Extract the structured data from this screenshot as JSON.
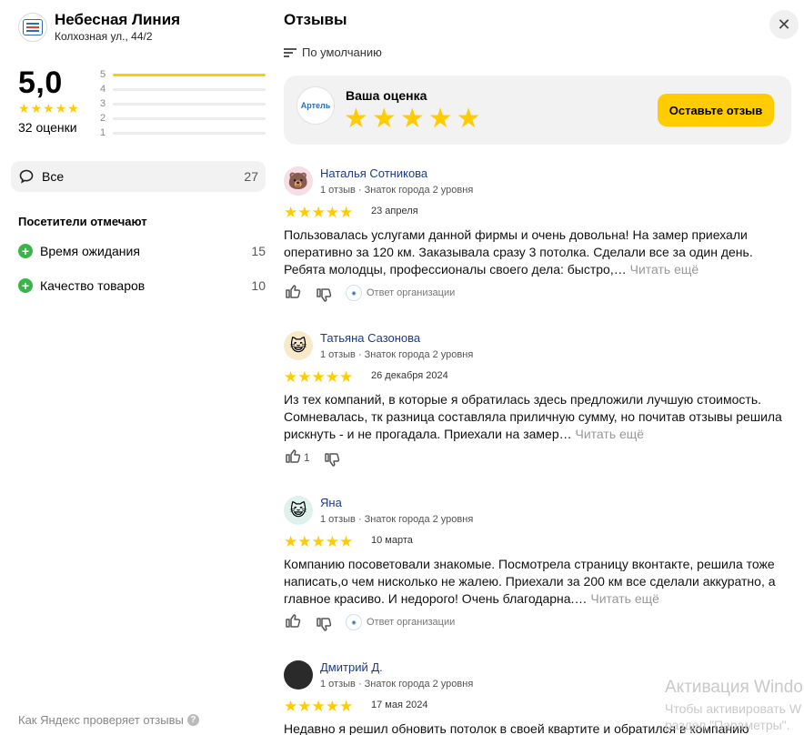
{
  "organization": {
    "name": "Небесная Линия",
    "address": "Колхозная ул., 44/2",
    "logo_icon": "company-logo"
  },
  "rating": {
    "value": "5,0",
    "stars": 5,
    "count_label": "32 оценки",
    "distribution": [
      {
        "label": "5",
        "fraction": 1.0
      },
      {
        "label": "4",
        "fraction": 0.0
      },
      {
        "label": "3",
        "fraction": 0.0
      },
      {
        "label": "2",
        "fraction": 0.0
      },
      {
        "label": "1",
        "fraction": 0.0
      }
    ]
  },
  "filters": {
    "all_label": "Все",
    "all_count": "27",
    "visitors_title": "Посетители отмечают",
    "tags": [
      {
        "label": "Время ожидания",
        "count": "15"
      },
      {
        "label": "Качество товаров",
        "count": "10"
      }
    ]
  },
  "footer": {
    "how_check": "Как Яндекс проверяет отзывы"
  },
  "reviews_panel": {
    "title": "Отзывы",
    "sort_label": "По умолчанию",
    "your_rating": {
      "title": "Ваша оценка",
      "logo_text": "Артель",
      "stars": 5,
      "button": "Оставьте отзыв"
    }
  },
  "reviews": [
    {
      "author": "Наталья Сотникова",
      "meta": "1 отзыв · Знаток города 2 уровня",
      "avatar": "bear-emoji",
      "avatar_glyph": "🐻",
      "avatar_bg": "#f6dde6",
      "stars": 5,
      "date": "23 апреля",
      "text": "Пользовалась услугами данной фирмы и очень довольна! На замер приехали оперативно за 120 км. Заказывала сразу 3 потолка. Сделали все за один день. Ребята молодцы, профессионалы своего дела: быстро,…",
      "more": "Читать ещё",
      "likes": "",
      "org_reply": "Ответ организации"
    },
    {
      "author": "Татьяна Сазонова",
      "meta": "1 отзыв · Знаток города 2 уровня",
      "avatar": "cat-emoji",
      "avatar_glyph": "😺",
      "avatar_bg": "#f8e9c9",
      "stars": 5,
      "date": "26 декабря 2024",
      "text": "Из тех компаний, в которые я обратилась здесь предложили лучшую стоимость. Сомневалась, тк разница составляла приличную сумму, но почитав отзывы решила рискнуть - и не прогадала. Приехали на замер…",
      "more": "Читать ещё",
      "likes": "1",
      "org_reply": ""
    },
    {
      "author": "Яна",
      "meta": "1 отзыв · Знаток города 2 уровня",
      "avatar": "cat-emoji",
      "avatar_glyph": "😺",
      "avatar_bg": "#dff1ec",
      "stars": 5,
      "date": "10 марта",
      "text": "Компанию посоветовали знакомые. Посмотрела страницу вконтакте, решила тоже написать,о чем нисколько не жалею. Приехали за 200 км все сделали аккуратно, а главное красиво. И недорого! Очень благодарна.…",
      "more": "Читать ещё",
      "likes": "",
      "org_reply": "Ответ организации"
    },
    {
      "author": "Дмитрий Д.",
      "meta": "1 отзыв · Знаток города 2 уровня",
      "avatar": "user-photo",
      "avatar_glyph": "",
      "avatar_bg": "#2a2a2a",
      "stars": 5,
      "date": "17 мая 2024",
      "text": "Недавно я решил обновить потолок в своей квартите и обратился в компанию",
      "more": "",
      "likes": "",
      "org_reply": ""
    }
  ],
  "watermark": {
    "line1": "Активация Windo",
    "line2": "Чтобы активировать W",
    "line3": "раздел \"Параметры\"."
  },
  "colors": {
    "accent": "#ffcc00",
    "link": "#1a3a8a",
    "tag_plus": "#3bb54a"
  }
}
